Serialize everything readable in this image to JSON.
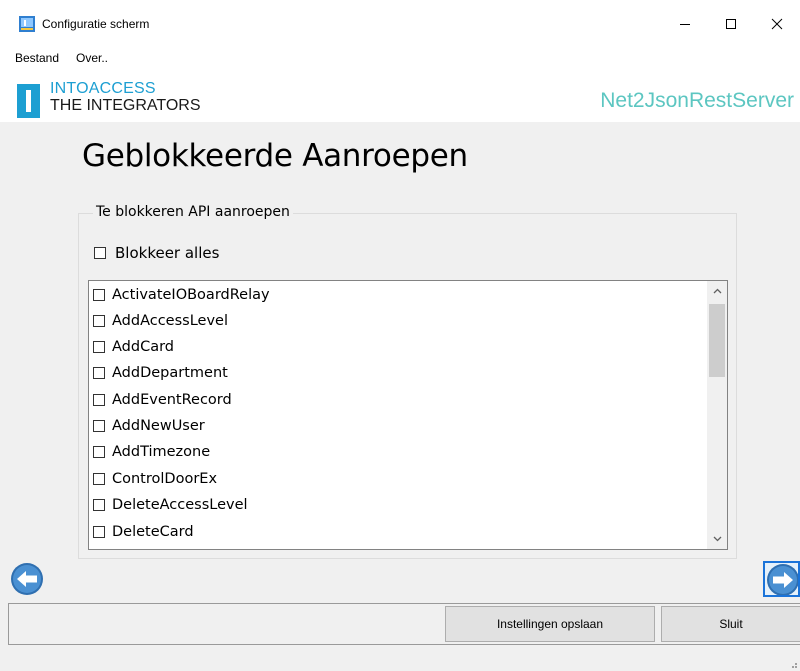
{
  "window": {
    "title": "Configuratie scherm",
    "minimize_icon": "minimize-icon",
    "maximize_icon": "maximize-icon",
    "close_icon": "close-icon"
  },
  "menu": {
    "items": [
      "Bestand",
      "Over.."
    ]
  },
  "header": {
    "logo_line1": "INTOACCESS",
    "logo_line2": "THE INTEGRATORS",
    "product_name": "Net2JsonRestServer",
    "logo_color": "#1d9fd2",
    "product_color": "#5cc6c1"
  },
  "page": {
    "title": "Geblokkeerde Aanroepen"
  },
  "group": {
    "legend": "Te blokkeren API aanroepen",
    "block_all_label": "Blokkeer alles",
    "block_all_checked": false
  },
  "api_list": {
    "items": [
      "ActivateIOBoardRelay",
      "AddAccessLevel",
      "AddCard",
      "AddDepartment",
      "AddEventRecord",
      "AddNewUser",
      "AddTimezone",
      "ControlDoorEx",
      "DeleteAccessLevel",
      "DeleteCard"
    ],
    "checked": [
      false,
      false,
      false,
      false,
      false,
      false,
      false,
      false,
      false,
      false
    ]
  },
  "navigation": {
    "prev_icon": "arrow-left-icon",
    "next_icon": "arrow-right-icon"
  },
  "footer": {
    "save_label": "Instellingen opslaan",
    "close_label": "Sluit"
  }
}
